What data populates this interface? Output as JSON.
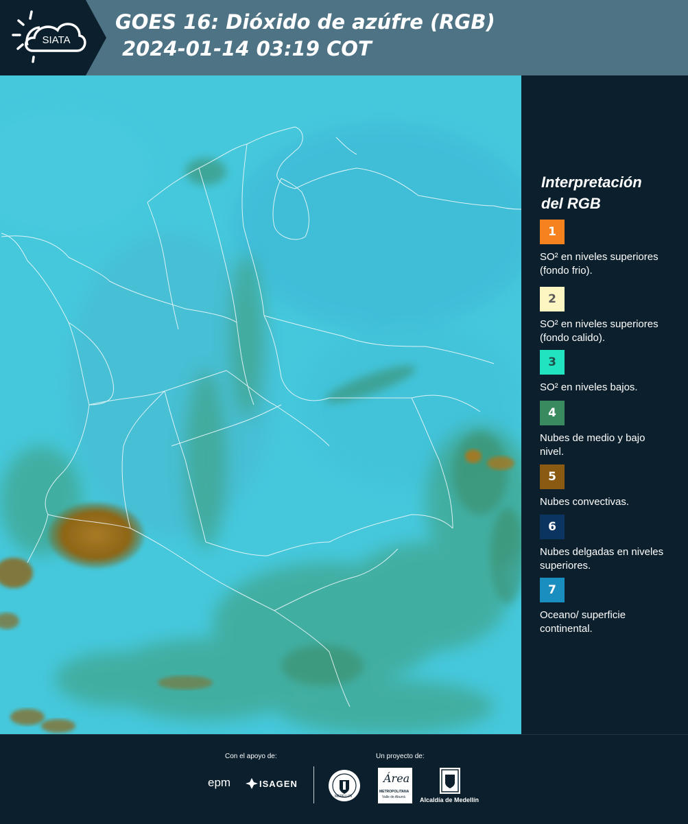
{
  "header": {
    "logo_text": "SIATA",
    "title_line1": "GOES 16: Dióxido de azúfre (RGB)",
    "title_line2": "2024-01-14 03:19 COT"
  },
  "legend": {
    "title_line1": "Interpretación",
    "title_line2": "del RGB",
    "items": [
      {
        "number": "1",
        "color": "#f5821f",
        "text_color": "#ffffff",
        "text": "SO² en niveles superiores (fondo frio)."
      },
      {
        "number": "2",
        "color": "#fdf6c3",
        "text_color": "#5a5a5a",
        "text": "SO² en niveles superiores (fondo calido)."
      },
      {
        "number": "3",
        "color": "#22e3c0",
        "text_color": "#1f4f4a",
        "text": "SO² en niveles bajos."
      },
      {
        "number": "4",
        "color": "#3a8a5f",
        "text_color": "#ffffff",
        "text": "Nubes de medio y bajo nivel."
      },
      {
        "number": "5",
        "color": "#8a5a12",
        "text_color": "#ffffff",
        "text": "Nubes convectivas."
      },
      {
        "number": "6",
        "color": "#0c3460",
        "text_color": "#ffffff",
        "text": "Nubes delgadas en niveles superiores."
      },
      {
        "number": "7",
        "color": "#1a8fbf",
        "text_color": "#ffffff",
        "text": "Oceano/ superficie continental."
      }
    ]
  },
  "footer": {
    "support_label": "Con el apoyo de:",
    "project_label": "Un proyecto de:",
    "epm": "epm",
    "isagen": "ISAGEN",
    "area_script": "Área",
    "area_line1": "METROPOLITANA",
    "area_line2": "Valle de Aburrá",
    "alcaldia": "Alcaldía de Medellín",
    "seal_text": "MEDELLÍN"
  },
  "colors": {
    "header_bg": "#4e7385",
    "logo_bg": "#0b1f2c",
    "page_bg": "#0b1f2c",
    "map_base": "#45c8dc"
  }
}
